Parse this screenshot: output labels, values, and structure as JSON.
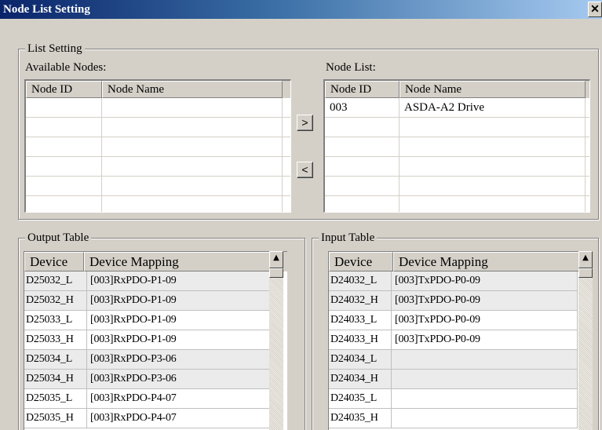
{
  "window": {
    "title": "Node List Setting",
    "close_label": "✕"
  },
  "list_setting": {
    "group_label": "List Setting",
    "available_label": "Available Nodes:",
    "nodelist_label": "Node List:",
    "columns": [
      "Node ID",
      "Node Name"
    ],
    "available_rows": [],
    "node_list_rows": [
      {
        "id": "003",
        "name": "ASDA-A2 Drive"
      }
    ],
    "add_button": ">",
    "remove_button": "<"
  },
  "output_table": {
    "group_label": "Output Table",
    "columns": [
      "Device",
      "Device Mapping"
    ],
    "rows": [
      {
        "device": "D25032_L",
        "mapping": "[003]RxPDO-P1-09",
        "shaded": true
      },
      {
        "device": "D25032_H",
        "mapping": "[003]RxPDO-P1-09",
        "shaded": true
      },
      {
        "device": "D25033_L",
        "mapping": "[003]RxPDO-P1-09",
        "shaded": false
      },
      {
        "device": "D25033_H",
        "mapping": "[003]RxPDO-P1-09",
        "shaded": false
      },
      {
        "device": "D25034_L",
        "mapping": "[003]RxPDO-P3-06",
        "shaded": true
      },
      {
        "device": "D25034_H",
        "mapping": "[003]RxPDO-P3-06",
        "shaded": true
      },
      {
        "device": "D25035_L",
        "mapping": "[003]RxPDO-P4-07",
        "shaded": false
      },
      {
        "device": "D25035_H",
        "mapping": "[003]RxPDO-P4-07",
        "shaded": false
      }
    ]
  },
  "input_table": {
    "group_label": "Input Table",
    "columns": [
      "Device",
      "Device Mapping"
    ],
    "rows": [
      {
        "device": "D24032_L",
        "mapping": "[003]TxPDO-P0-09",
        "shaded": true
      },
      {
        "device": "D24032_H",
        "mapping": "[003]TxPDO-P0-09",
        "shaded": true
      },
      {
        "device": "D24033_L",
        "mapping": "[003]TxPDO-P0-09",
        "shaded": false
      },
      {
        "device": "D24033_H",
        "mapping": "[003]TxPDO-P0-09",
        "shaded": false
      },
      {
        "device": "D24034_L",
        "mapping": "",
        "shaded": true
      },
      {
        "device": "D24034_H",
        "mapping": "",
        "shaded": true
      },
      {
        "device": "D24035_L",
        "mapping": "",
        "shaded": false
      },
      {
        "device": "D24035_H",
        "mapping": "",
        "shaded": false
      }
    ]
  },
  "scrollbar": {
    "up_icon": "▲"
  }
}
